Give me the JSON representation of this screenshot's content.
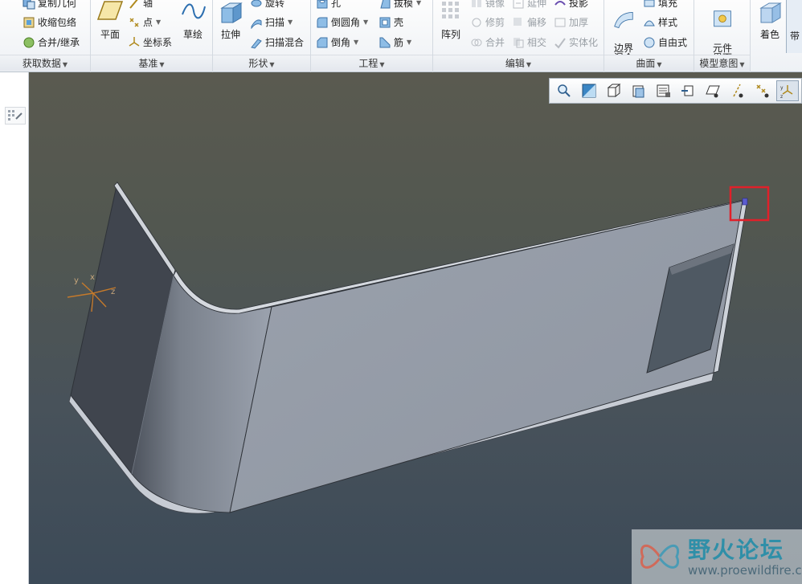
{
  "ribbon": {
    "groups": {
      "get_data": {
        "label": "获取数据",
        "copy_geometry": "复制几何",
        "shrinkwrap": "收缩包络",
        "merge_inherit": "合并/继承"
      },
      "datum": {
        "label": "基准",
        "plane": "平面",
        "axis": "轴",
        "point": "点",
        "csys": "坐标系",
        "sketch": "草绘"
      },
      "shapes": {
        "label": "形状",
        "extrude": "拉伸",
        "revolve": "旋转",
        "sweep": "扫描",
        "swept_blend": "扫描混合"
      },
      "engineering": {
        "label": "工程",
        "hole": "孔",
        "draft": "拔模",
        "round": "倒圆角",
        "shell": "壳",
        "chamfer": "倒角",
        "rib": "筋"
      },
      "editing": {
        "label": "编辑",
        "pattern": "阵列",
        "mirror": "镜像",
        "extend": "延伸",
        "project": "投影",
        "trim": "修剪",
        "offset": "偏移",
        "thicken": "加厚",
        "merge": "合并",
        "intersect": "相交",
        "solidify": "实体化"
      },
      "surfaces": {
        "label": "曲面",
        "boundary_blend": "边界\n混合",
        "fill": "填充",
        "style": "样式",
        "freestyle": "自由式"
      },
      "model_intent": {
        "label": "模型意图",
        "component_interface": "元件\n界面"
      },
      "extra": {
        "color": "着色",
        "with": "带"
      }
    }
  },
  "viewport": {
    "csys": {
      "x": "x",
      "y": "y",
      "z": "z"
    },
    "highlight_color": "#e0202a"
  },
  "watermark": {
    "title": "野火论坛",
    "url": "www.proewildfire.cn"
  }
}
